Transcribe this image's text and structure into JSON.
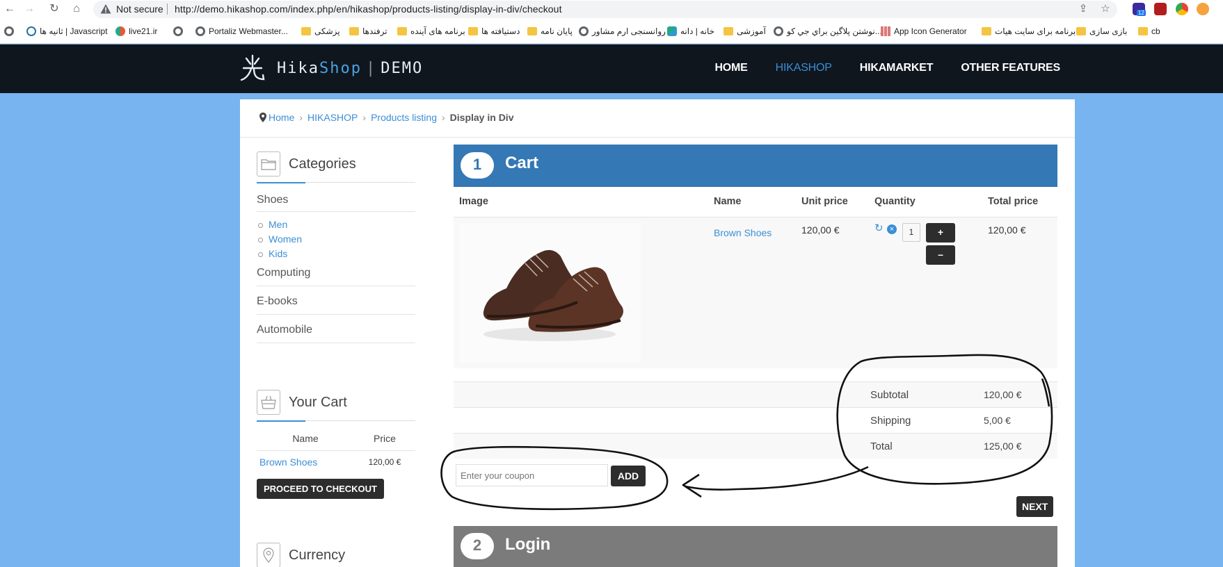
{
  "browser": {
    "security_label": "Not secure",
    "url": "http://demo.hikashop.com/index.php/en/hikashop/products-listing/display-in-div/checkout",
    "extension_badge": "12"
  },
  "bookmarks": [
    {
      "label": "ثانیه ها | Javascript",
      "icon": "wordpress-icon"
    },
    {
      "label": "live21.ir",
      "icon": "site-icon"
    },
    {
      "label": "",
      "icon": "globe-icon"
    },
    {
      "label": "Portaliz Webmaster...",
      "icon": "globe-icon"
    },
    {
      "label": "پزشکی",
      "icon": "folder-icon"
    },
    {
      "label": "ترفندها",
      "icon": "folder-icon"
    },
    {
      "label": "برنامه های آینده",
      "icon": "folder-icon"
    },
    {
      "label": "دستیافته ها",
      "icon": "folder-icon"
    },
    {
      "label": "پایان نامه",
      "icon": "folder-icon"
    },
    {
      "label": "روانسنجی ارم مشاور",
      "icon": "globe-icon"
    },
    {
      "label": "خانه | دانه",
      "icon": "site-icon"
    },
    {
      "label": "آموزشی",
      "icon": "folder-icon"
    },
    {
      "label": "نوشتن پلاگین براي جي کو...",
      "icon": "globe-icon"
    },
    {
      "label": "App Icon Generator",
      "icon": "grid-icon"
    },
    {
      "label": "برنامه برای سایت هیات",
      "icon": "folder-icon"
    },
    {
      "label": "بازی سازی",
      "icon": "folder-icon"
    },
    {
      "label": "cb",
      "icon": "folder-icon"
    }
  ],
  "site": {
    "logo_part1": "Hika",
    "logo_part2": "Shop",
    "logo_sep": "|",
    "logo_part3": "DEMO",
    "nav": [
      "HOME",
      "HIKASHOP",
      "HIKAMARKET",
      "OTHER FEATURES"
    ]
  },
  "breadcrumb": [
    "Home",
    "HIKASHOP",
    "Products listing",
    "Display in Div"
  ],
  "sidebar": {
    "categories_title": "Categories",
    "categories": {
      "shoes": "Shoes",
      "shoes_sub": [
        "Men",
        "Women",
        "Kids"
      ],
      "computing": "Computing",
      "ebooks": "E-books",
      "automobile": "Automobile"
    },
    "cart_title": "Your Cart",
    "cart_headers": [
      "Name",
      "Price"
    ],
    "cart_item_name": "Brown Shoes",
    "cart_item_price": "120,00 €",
    "checkout_button": "PROCEED TO CHECKOUT",
    "currency_title": "Currency"
  },
  "checkout": {
    "step1_number": "1",
    "step1_label": "Cart",
    "headers": [
      "Image",
      "Name",
      "Unit price",
      "Quantity",
      "Total price"
    ],
    "item": {
      "name": "Brown Shoes",
      "unit_price": "120,00 €",
      "quantity": "1",
      "total_price": "120,00 €",
      "plus": "+",
      "minus": "–"
    },
    "totals": [
      {
        "label": "Subtotal",
        "value": "120,00 €"
      },
      {
        "label": "Shipping",
        "value": "5,00 €"
      },
      {
        "label": "Total",
        "value": "125,00 €"
      }
    ],
    "coupon_placeholder": "Enter your coupon",
    "add_button": "ADD",
    "next_button": "NEXT",
    "step2_number": "2",
    "step2_label": "Login"
  },
  "colors": {
    "page_bg": "#78b4ef",
    "header_bg": "#0f161d",
    "accent": "#3b8fd6",
    "step1_bg": "#3478b5",
    "step2_bg": "#7b7b7b",
    "button_dark": "#2d2d2d"
  }
}
